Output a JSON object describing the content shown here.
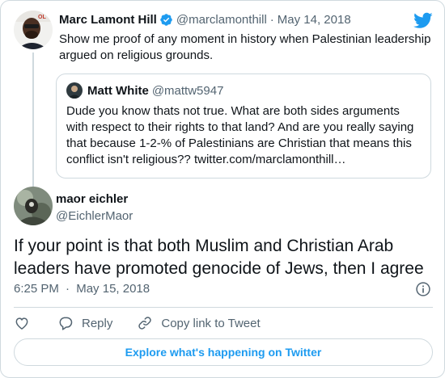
{
  "parent_tweet": {
    "display_name": "Marc Lamont Hill",
    "handle": "@marclamonthill",
    "separator": "·",
    "date": "May 14, 2018",
    "text": "Show me proof of any moment in history when Palestinian leadership argued on religious grounds.",
    "avatar_icon": "user-avatar-photo",
    "verified_icon": "verified-badge-icon",
    "brand_color": "#1d9bf0"
  },
  "quote_tweet": {
    "display_name": "Matt White",
    "handle": "@mattw5947",
    "text": "Dude you know thats not true.  What are both sides arguments with respect to their rights to that land?  And are you really saying that because 1-2-% of Palestinians are Christian that means this conflict isn't religious?? twitter.com/marclamonthill…"
  },
  "main_tweet": {
    "display_name": "maor eichler",
    "handle": "@EichlerMaor",
    "text": "If your point is that both Muslim and Christian Arab leaders have promoted genocide of Jews, then I agree",
    "time": "6:25 PM",
    "separator": "·",
    "date": "May 15, 2018"
  },
  "actions": {
    "reply_label": "Reply",
    "copy_link_label": "Copy link to Tweet"
  },
  "footer": {
    "explore_label": "Explore what's happening on Twitter"
  },
  "colors": {
    "text_primary": "#0f1419",
    "text_secondary": "#536471",
    "border": "#cfd9de",
    "accent": "#1d9bf0"
  }
}
